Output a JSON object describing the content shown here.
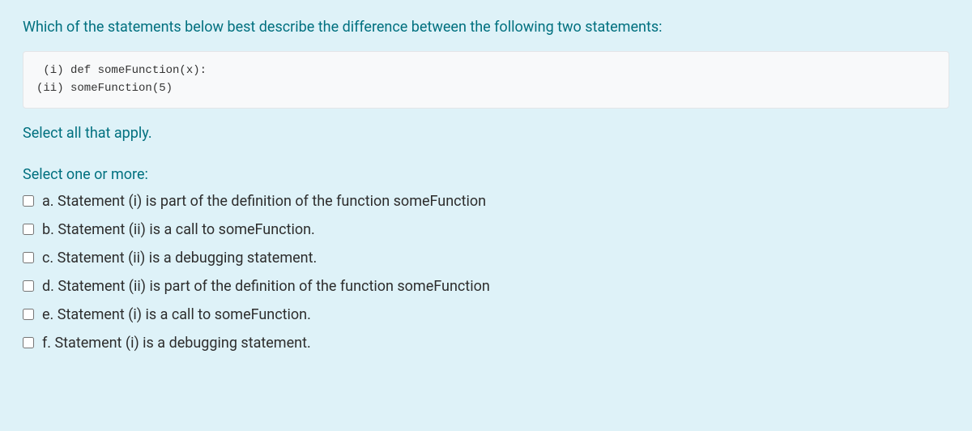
{
  "question": {
    "prompt": "Which of the statements below best describe the difference between the following two statements:",
    "code": " (i) def someFunction(x):\n(ii) someFunction(5)",
    "instruction": "Select all that apply.",
    "selectPrompt": "Select one or more:",
    "options": [
      {
        "letter": "a.",
        "text": "Statement (i) is part of the definition of the function someFunction"
      },
      {
        "letter": "b.",
        "text": "Statement (ii) is a call to someFunction."
      },
      {
        "letter": "c.",
        "text": "Statement (ii) is a debugging statement."
      },
      {
        "letter": "d.",
        "text": "Statement (ii) is part of the definition of the function someFunction"
      },
      {
        "letter": "e.",
        "text": "Statement (i) is a call to someFunction."
      },
      {
        "letter": "f.",
        "text": "Statement (i) is a debugging statement."
      }
    ]
  }
}
